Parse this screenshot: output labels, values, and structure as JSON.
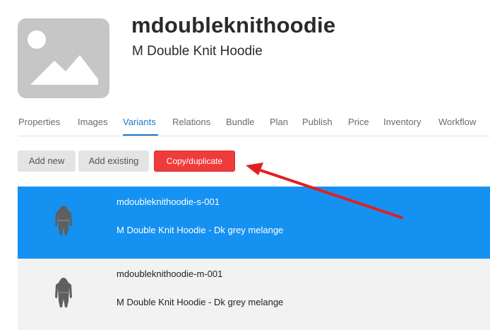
{
  "product": {
    "image_icon": "image-placeholder-icon",
    "code": "mdoubleknithoodie",
    "name": "M Double Knit Hoodie"
  },
  "tabs": [
    {
      "label": "Properties",
      "active": false
    },
    {
      "label": "Images",
      "active": false
    },
    {
      "label": "Variants",
      "active": true
    },
    {
      "label": "Relations",
      "active": false
    },
    {
      "label": "Bundle",
      "active": false
    },
    {
      "label": "Plan",
      "active": false
    },
    {
      "label": "Publish",
      "active": false
    },
    {
      "label": "Price",
      "active": false
    },
    {
      "label": "Inventory",
      "active": false
    },
    {
      "label": "Workflow",
      "active": false
    }
  ],
  "actions": {
    "add_new": "Add new",
    "add_existing": "Add existing",
    "copy_duplicate": "Copy/duplicate"
  },
  "variants": [
    {
      "code": "mdoubleknithoodie-s-001",
      "description": "M Double Knit Hoodie - Dk grey melange",
      "selected": true,
      "thumb_icon": "hoodie-thumbnail"
    },
    {
      "code": "mdoubleknithoodie-m-001",
      "description": "M Double Knit Hoodie - Dk grey melange",
      "selected": false,
      "thumb_icon": "hoodie-thumbnail"
    }
  ],
  "colors": {
    "accent_blue": "#1f78c8",
    "selected_row": "#1591f2",
    "danger_button": "#ef3b3b",
    "annotation_arrow": "#e02020"
  }
}
